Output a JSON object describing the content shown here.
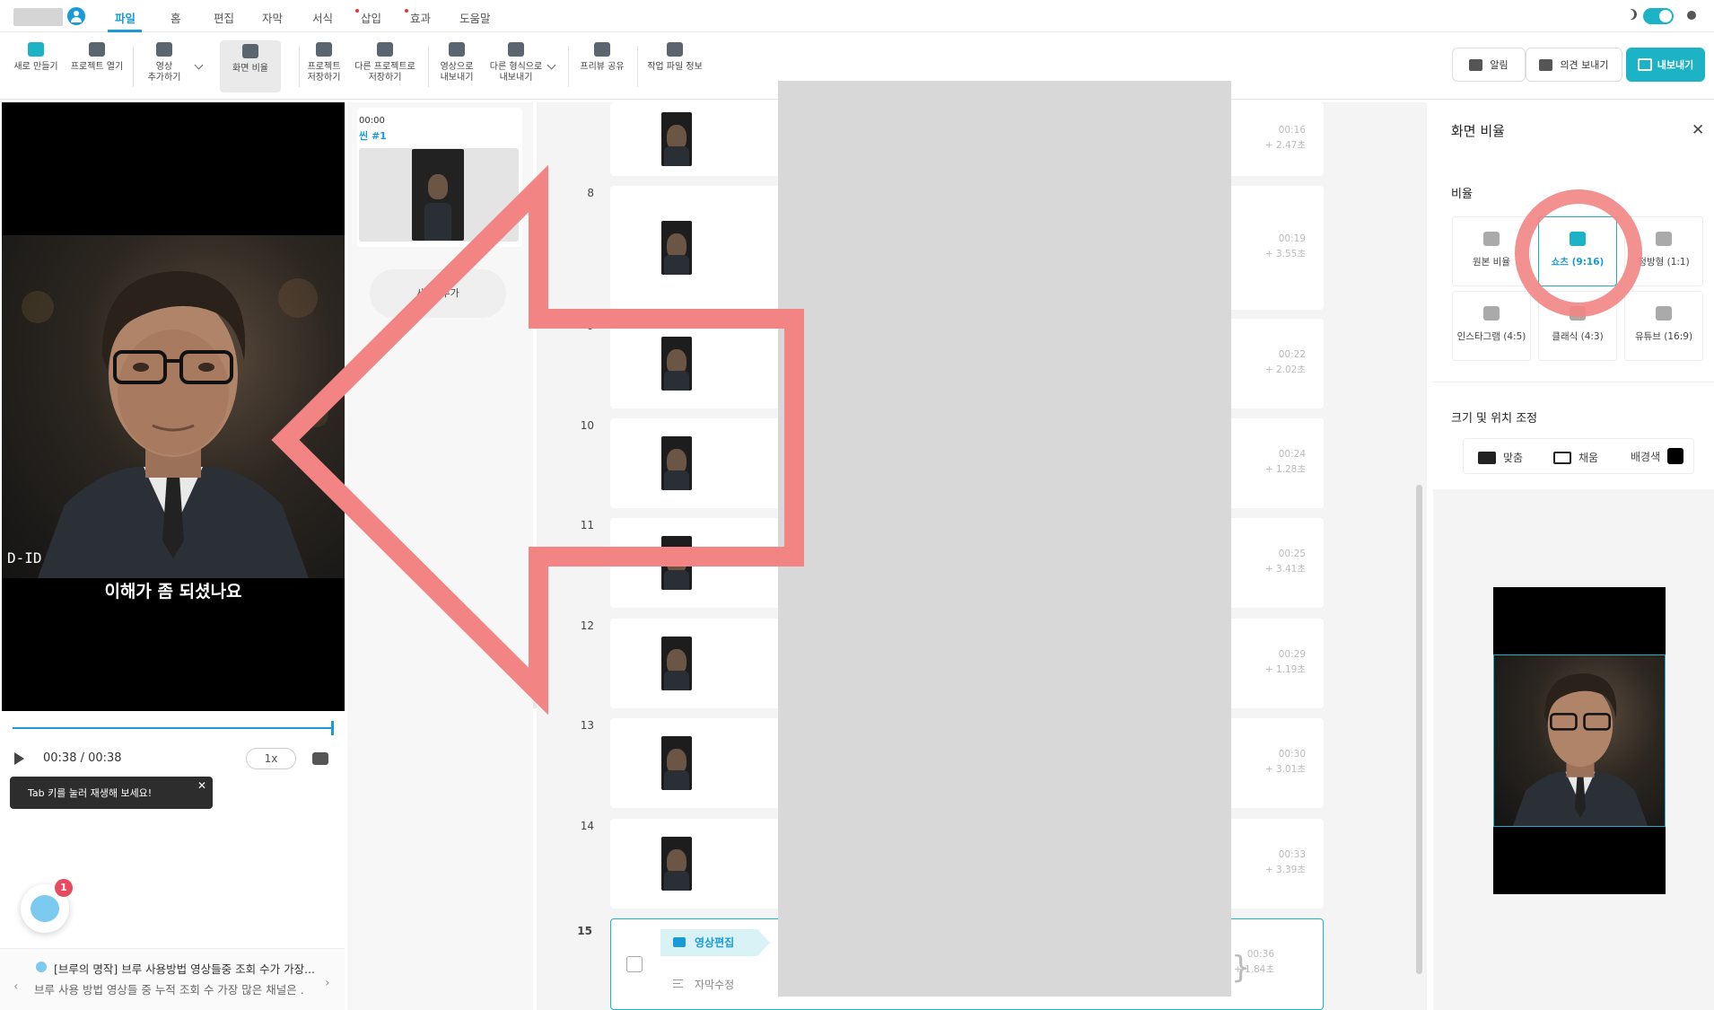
{
  "menu": {
    "items": [
      "파일",
      "홈",
      "편집",
      "자막",
      "서식",
      "삽입",
      "효과",
      "도움말"
    ],
    "active": "파일"
  },
  "toolbar": {
    "new": "새로 만들기",
    "open": "프로젝트 열기",
    "add_video_1": "영상",
    "add_video_2": "추가하기",
    "aspect": "화면 비율",
    "save_1": "프로젝트",
    "save_2": "저장하기",
    "save_as_1": "다른 프로젝트로",
    "save_as_2": "저장하기",
    "export_video_1": "영상으로",
    "export_video_2": "내보내기",
    "export_other_1": "다른 형식으로",
    "export_other_2": "내보내기",
    "preview_share": "프리뷰 공유",
    "file_info": "작업 파일 정보",
    "notifications": "알림",
    "feedback": "의견 보내기",
    "export": "내보내기"
  },
  "preview": {
    "subtitle": "이해가 좀 되셨나요",
    "watermark": "D-ID",
    "time": "00:38 / 00:38",
    "speed": "1x",
    "progress": 1.0,
    "tooltip": "Tab 키를 눌러 재생해 보세요!"
  },
  "chat": {
    "badge": "1"
  },
  "news": {
    "title": "[브루의 명작] 브루 사용방법 영상들중 조회 수가 가장...",
    "desc": "브루 사용 방법 영상들 중 누적 조회 수 가장 많은 채널은 ..."
  },
  "scenes": [
    {
      "time": "00:00",
      "name": "씬 #1"
    }
  ],
  "add_scene": "새 씬 추가",
  "timeline": {
    "rows": [
      {
        "num": "",
        "time": "00:16",
        "dur": "+ 2.47초"
      },
      {
        "num": "8",
        "time": "00:19",
        "dur": "+ 3.55초"
      },
      {
        "num": "9",
        "time": "00:22",
        "dur": "+ 2.02초"
      },
      {
        "num": "10",
        "time": "00:24",
        "dur": "+ 1.28초"
      },
      {
        "num": "11",
        "time": "00:25",
        "dur": "+ 3.41초"
      },
      {
        "num": "12",
        "time": "00:29",
        "dur": "+ 1.19초"
      },
      {
        "num": "13",
        "time": "00:30",
        "dur": "+ 3.01초"
      },
      {
        "num": "14",
        "time": "00:33",
        "dur": "+ 3.39초"
      }
    ],
    "last": {
      "num": "15",
      "time": "00:36",
      "dur": "+ 1.84초",
      "tag_edit": "영상편집",
      "tag_sub": "자막수정"
    }
  },
  "right_panel": {
    "title": "화면 비율",
    "ratio_label": "비율",
    "ratios": [
      "원본 비율",
      "쇼츠 (9:16)",
      "정방형 (1:1)",
      "인스타그램 (4:5)",
      "클래식 (4:3)",
      "유튜브 (16:9)"
    ],
    "selected_ratio": "쇼츠 (9:16)",
    "size_label": "크기 및 위치 조정",
    "fit": "맞춤",
    "fill": "채움",
    "bg_color": "배경색",
    "bg_color_value": "#000000"
  },
  "colors": {
    "accent": "#1db3c7",
    "link": "#1a9ad6",
    "annotation": "#f28484"
  }
}
